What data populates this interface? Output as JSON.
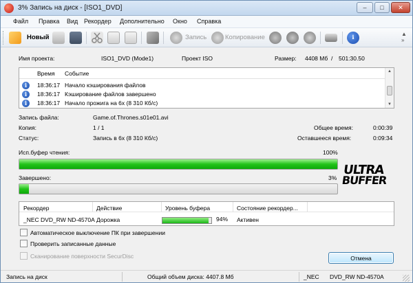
{
  "window": {
    "title": "3% Запись на диск - [ISO1_DVD]",
    "buttons": {
      "minimize": "‒",
      "maximize": "□",
      "close": "✕"
    }
  },
  "menu": [
    "Файл",
    "Правка",
    "Вид",
    "Рекордер",
    "Дополнительно",
    "Окно",
    "Справка"
  ],
  "toolbar": {
    "new_label": "Новый",
    "burn_label": "Запись",
    "copy_label": "Копирование"
  },
  "project": {
    "name_label": "Имя проекта:",
    "name_value": "ISO1_DVD (Mode1)",
    "type_value": "Проект ISO",
    "size_label": "Размер:",
    "size_value": "4408 Мб",
    "size_sep": "/",
    "duration_value": "501:30.50"
  },
  "log": {
    "col_time": "Время",
    "col_event": "Событие",
    "rows": [
      {
        "time": "18:36:17",
        "event": "Начало кэширования файлов"
      },
      {
        "time": "18:36:17",
        "event": "Кэширование файлов завершено"
      },
      {
        "time": "18:36:17",
        "event": "Начало прожига на 6х (8 310 Кб/с)"
      }
    ]
  },
  "details": {
    "file_label": "Запись файла:",
    "file_value": "Game.of.Thrones.s01e01.avi",
    "copy_label": "Копия:",
    "copy_value": "1 / 1",
    "total_time_label": "Общее время:",
    "total_time_value": "0:00:39",
    "status_label": "Статус:",
    "status_value": "Запись в 6х (8 310 Кб/с)",
    "remaining_label": "Оставшееся время:",
    "remaining_value": "0:09:34"
  },
  "read_buffer": {
    "label": "Исп.буфер чтения:",
    "percent_text": "100%",
    "fraction": 1.0
  },
  "completed": {
    "label": "Завершено:",
    "percent_text": "3%",
    "fraction": 0.03
  },
  "logo": {
    "line1": "ULTRA",
    "line2": "BUFFER"
  },
  "recorder_table": {
    "headers": [
      "Рекордер",
      "Действие",
      "Уровень буфера",
      "Состояние рекордер..."
    ],
    "row": {
      "recorder": "_NEC DVD_RW ND-4570A",
      "action": "Дорожка",
      "buffer_text": "94%",
      "buffer_fraction": 0.94,
      "state": "Активен"
    }
  },
  "options": [
    {
      "label": "Автоматическое выключение ПК при завершении",
      "checked": false,
      "disabled": false
    },
    {
      "label": "Проверить записанные данные",
      "checked": false,
      "disabled": false
    },
    {
      "label": "Сканирование поверхности SecurDisc",
      "checked": false,
      "disabled": true
    }
  ],
  "cancel_label": "Отмена",
  "statusbar": {
    "left": "Запись на диск",
    "center": "Общий объем диска: 4407.8 Мб",
    "drive_prefix": "_NEC",
    "drive_name": "DVD_RW ND-4570A"
  },
  "colors": {
    "progress_green": "#22c41a",
    "accent_blue": "#1c4fae",
    "close_red": "#c3422d"
  }
}
